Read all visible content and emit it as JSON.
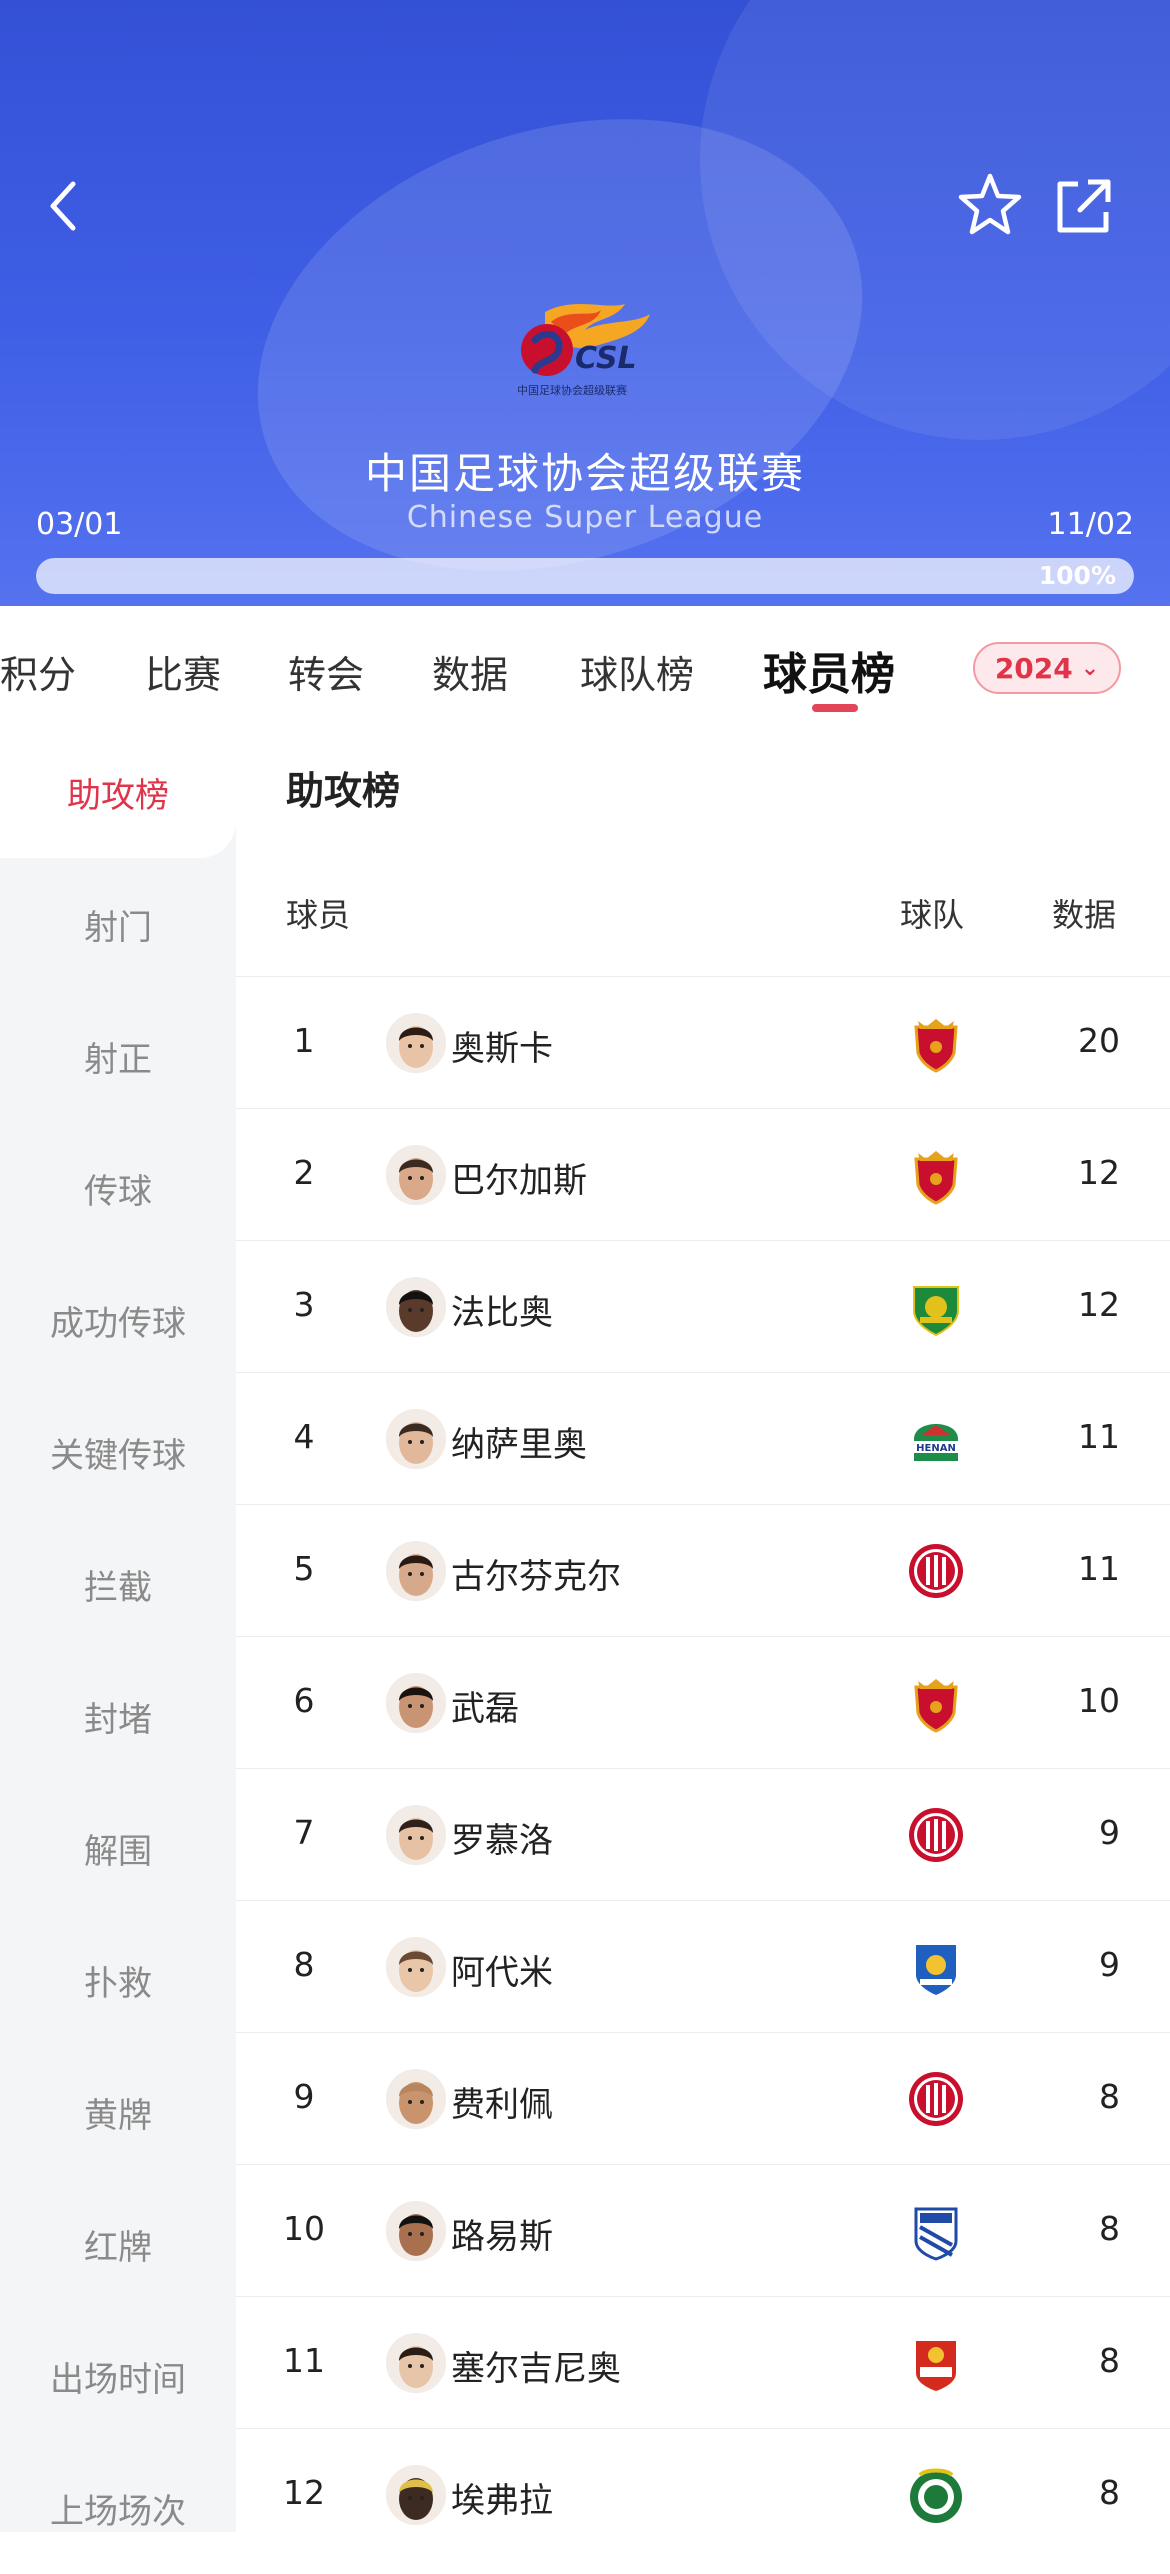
{
  "header": {
    "title_cn": "中国足球协会超级联赛",
    "title_en": "Chinese Super League",
    "logo_text": "CSL",
    "logo_sub": "中国足球协会超级联赛",
    "start_date": "03/01",
    "end_date": "11/02",
    "progress_label": "100%",
    "progress": 1.0
  },
  "tabs": [
    {
      "label": "积分"
    },
    {
      "label": "比赛"
    },
    {
      "label": "转会"
    },
    {
      "label": "数据"
    },
    {
      "label": "球队榜"
    },
    {
      "label": "球员榜",
      "active": true
    }
  ],
  "season": {
    "label": "2024"
  },
  "sidebar": [
    {
      "label": "助攻榜",
      "active": true
    },
    {
      "label": "射门"
    },
    {
      "label": "射正"
    },
    {
      "label": "传球"
    },
    {
      "label": "成功传球"
    },
    {
      "label": "关键传球"
    },
    {
      "label": "拦截"
    },
    {
      "label": "封堵"
    },
    {
      "label": "解围"
    },
    {
      "label": "扑救"
    },
    {
      "label": "黄牌"
    },
    {
      "label": "红牌"
    },
    {
      "label": "出场时间"
    },
    {
      "label": "上场场次"
    }
  ],
  "main": {
    "section_title": "助攻榜",
    "columns": {
      "player": "球员",
      "team": "球队",
      "data": "数据"
    },
    "rows": [
      {
        "rank": "1",
        "name": "奥斯卡",
        "value": "20",
        "team_icon": "shanghai-port-crest-icon"
      },
      {
        "rank": "2",
        "name": "巴尔加斯",
        "value": "12",
        "team_icon": "shanghai-port-crest-icon"
      },
      {
        "rank": "3",
        "name": "法比奥",
        "value": "12",
        "team_icon": "beijing-guoan-crest-icon"
      },
      {
        "rank": "4",
        "name": "纳萨里奥",
        "value": "11",
        "team_icon": "henan-crest-icon"
      },
      {
        "rank": "5",
        "name": "古尔芬克尔",
        "value": "11",
        "team_icon": "chengdu-rongcheng-crest-icon"
      },
      {
        "rank": "6",
        "name": "武磊",
        "value": "10",
        "team_icon": "shanghai-port-crest-icon"
      },
      {
        "rank": "7",
        "name": "罗慕洛",
        "value": "9",
        "team_icon": "chengdu-rongcheng-crest-icon"
      },
      {
        "rank": "8",
        "name": "阿代米",
        "value": "9",
        "team_icon": "tianjin-crest-icon"
      },
      {
        "rank": "9",
        "name": "费利佩",
        "value": "8",
        "team_icon": "chengdu-rongcheng-crest-icon"
      },
      {
        "rank": "10",
        "name": "路易斯",
        "value": "8",
        "team_icon": "shanghai-shenhua-crest-icon"
      },
      {
        "rank": "11",
        "name": "塞尔吉尼奥",
        "value": "8",
        "team_icon": "changchun-yatai-crest-icon"
      },
      {
        "rank": "12",
        "name": "埃弗拉",
        "value": "8",
        "team_icon": "zhejiang-crest-icon"
      }
    ]
  },
  "colors": {
    "accent": "#e0344a",
    "hero": "#3f5fe6"
  }
}
